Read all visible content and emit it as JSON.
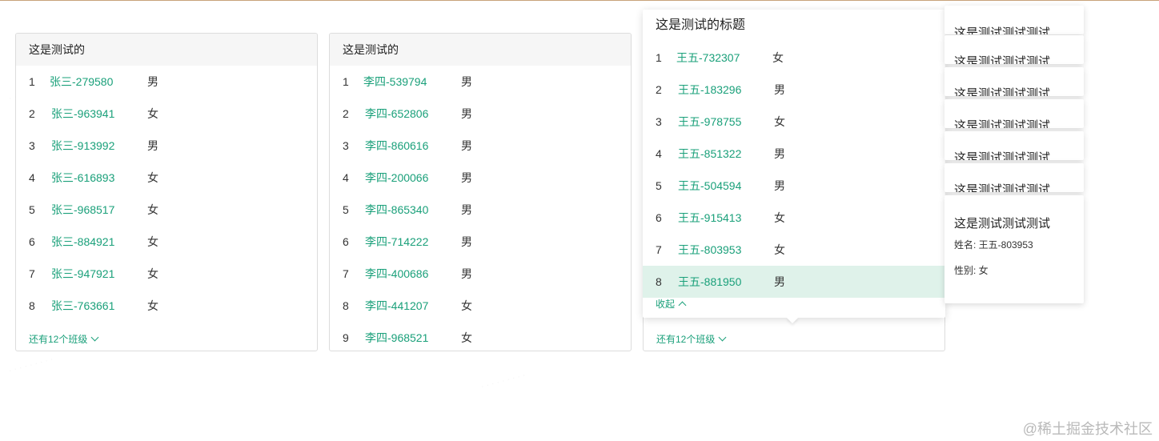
{
  "brand": "@稀土掘金技术社区",
  "card1": {
    "title": "这是测试的",
    "more": "还有12个班级",
    "rows": [
      {
        "idx": "1",
        "name": "张三-279580",
        "sex": "男"
      },
      {
        "idx": "2",
        "name": "张三-963941",
        "sex": "女"
      },
      {
        "idx": "3",
        "name": "张三-913992",
        "sex": "男"
      },
      {
        "idx": "4",
        "name": "张三-616893",
        "sex": "女"
      },
      {
        "idx": "5",
        "name": "张三-968517",
        "sex": "女"
      },
      {
        "idx": "6",
        "name": "张三-884921",
        "sex": "女"
      },
      {
        "idx": "7",
        "name": "张三-947921",
        "sex": "女"
      },
      {
        "idx": "8",
        "name": "张三-763661",
        "sex": "女"
      }
    ]
  },
  "card2": {
    "title": "这是测试的",
    "rows": [
      {
        "idx": "1",
        "name": "李四-539794",
        "sex": "男"
      },
      {
        "idx": "2",
        "name": "李四-652806",
        "sex": "男"
      },
      {
        "idx": "3",
        "name": "李四-860616",
        "sex": "男"
      },
      {
        "idx": "4",
        "name": "李四-200066",
        "sex": "男"
      },
      {
        "idx": "5",
        "name": "李四-865340",
        "sex": "男"
      },
      {
        "idx": "6",
        "name": "李四-714222",
        "sex": "男"
      },
      {
        "idx": "7",
        "name": "李四-400686",
        "sex": "男"
      },
      {
        "idx": "8",
        "name": "李四-441207",
        "sex": "女"
      },
      {
        "idx": "9",
        "name": "李四-968521",
        "sex": "女"
      }
    ]
  },
  "card3": {
    "more": "还有12个班级"
  },
  "popup": {
    "title": "这是测试的标题",
    "collapse": "收起",
    "rows": [
      {
        "idx": "1",
        "name": "王五-732307",
        "sex": "女"
      },
      {
        "idx": "2",
        "name": "王五-183296",
        "sex": "男"
      },
      {
        "idx": "3",
        "name": "王五-978755",
        "sex": "女"
      },
      {
        "idx": "4",
        "name": "王五-851322",
        "sex": "男"
      },
      {
        "idx": "5",
        "name": "王五-504594",
        "sex": "男"
      },
      {
        "idx": "6",
        "name": "王五-915413",
        "sex": "女"
      },
      {
        "idx": "7",
        "name": "王五-803953",
        "sex": "女"
      },
      {
        "idx": "8",
        "name": "王五-881950",
        "sex": "男"
      }
    ]
  },
  "tooltips": {
    "stacked_title": "这是测试测试测试",
    "full": {
      "title": "这是测试测试测试",
      "name_line": "姓名: 王五-803953",
      "sex_line": "性别: 女"
    }
  }
}
